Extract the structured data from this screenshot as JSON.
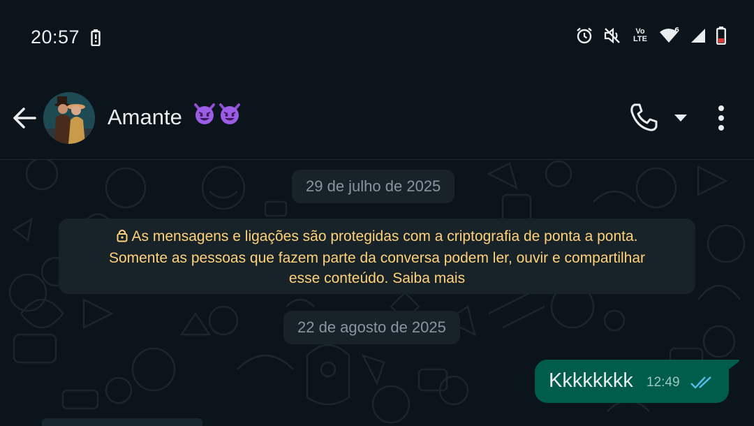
{
  "status_bar": {
    "time": "20:57",
    "icons": [
      "battery-saver-icon",
      "alarm-icon",
      "mute-icon",
      "volte-icon",
      "wifi-icon",
      "signal-icon",
      "battery-low-icon"
    ],
    "volte_top": "Vo",
    "volte_bottom": "LTE",
    "wifi_badge": "6",
    "battery_color": "#e53935"
  },
  "header": {
    "contact_name": "Amante",
    "emoji": [
      "smiling-imp-emoji",
      "smiling-imp-emoji"
    ],
    "actions": [
      "back-arrow-icon",
      "phone-icon",
      "caret-down-icon",
      "more-vert-icon"
    ]
  },
  "chat": {
    "date_chip_1": "29 de julho de 2025",
    "encryption_line1": "As mensagens e ligações são protegidas com a criptografia de ponta a ponta.",
    "encryption_line2": "Somente as pessoas que fazem parte da conversa podem ler, ouvir e compartilhar",
    "encryption_line3": "esse conteúdo. Saiba mais",
    "date_chip_2": "22 de agosto de 2025",
    "messages": [
      {
        "direction": "outgoing",
        "text": "Kkkkkkkk",
        "time": "12:49",
        "status": "read"
      }
    ]
  },
  "colors": {
    "background": "#0b141a",
    "chip": "#182229",
    "outgoing_bubble": "#005c4b",
    "encryption_text": "#ffd279",
    "read_ticks": "#53bdeb"
  }
}
